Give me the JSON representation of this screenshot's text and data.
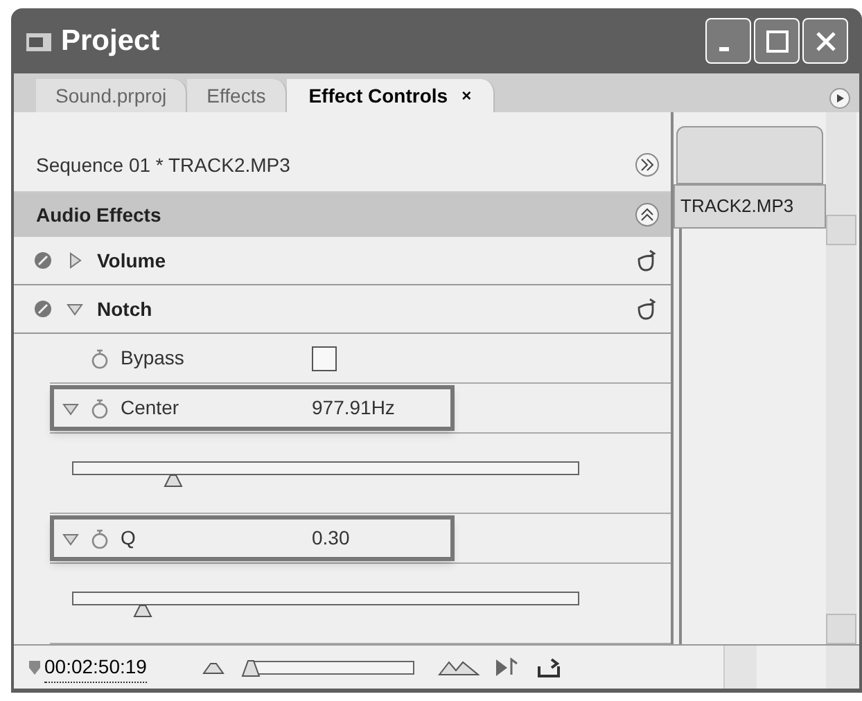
{
  "window": {
    "title": "Project"
  },
  "tabs": [
    {
      "label": "Sound.prproj",
      "selected": false
    },
    {
      "label": "Effects",
      "selected": false
    },
    {
      "label": "Effect Controls",
      "selected": true,
      "close": "×"
    }
  ],
  "sequence": {
    "label": "Sequence 01 * TRACK2.MP3"
  },
  "section": {
    "title": "Audio Effects"
  },
  "effects": [
    {
      "name": "Volume",
      "expanded": false
    },
    {
      "name": "Notch",
      "expanded": true,
      "params": [
        {
          "kind": "checkbox",
          "name": "Bypass",
          "checked": false,
          "highlighted": false
        },
        {
          "kind": "slider",
          "name": "Center",
          "value": "977.91Hz",
          "level": 0.2,
          "highlighted": true
        },
        {
          "kind": "slider",
          "name": "Q",
          "value": "0.30",
          "level": 0.14,
          "highlighted": true
        }
      ]
    }
  ],
  "timeline": {
    "clip": "TRACK2.MP3"
  },
  "bottom_bar": {
    "timecode": "00:02:50:19",
    "zoom_slider": {
      "level": 0.02
    }
  }
}
